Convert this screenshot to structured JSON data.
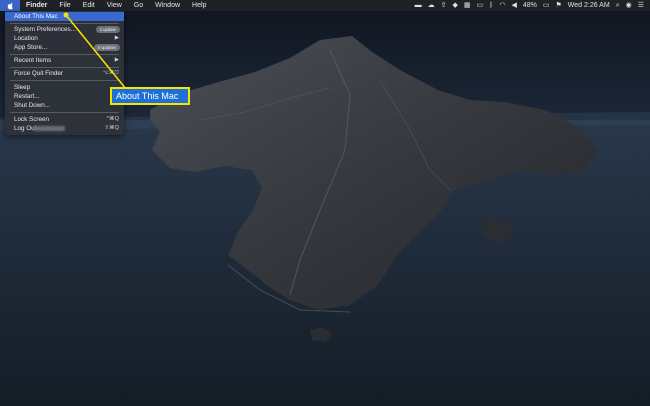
{
  "colors": {
    "accent": "#3a6ad0",
    "callout_border": "#f3e600",
    "callout_fill": "#1e6fd6"
  },
  "menubar": {
    "apple_icon": "apple-icon",
    "app_name": "Finder",
    "items": [
      "File",
      "Edit",
      "View",
      "Go",
      "Window",
      "Help"
    ],
    "status": {
      "battery": "48%",
      "clock": "Wed 2:26 AM"
    }
  },
  "apple_menu": {
    "about": "About This Mac",
    "system_prefs": "System Preferences...",
    "system_prefs_badge": "1 update",
    "location": "Location",
    "app_store": "App Store...",
    "app_store_badge": "8 updates",
    "recent_items": "Recent Items",
    "force_quit": "Force Quit Finder",
    "force_quit_shortcut": "⌥⌘⎋",
    "sleep": "Sleep",
    "restart": "Restart...",
    "shut_down": "Shut Down...",
    "lock_screen": "Lock Screen",
    "lock_screen_shortcut": "^⌘Q",
    "log_out": "Log Out",
    "log_out_shortcut": "⇧⌘Q"
  },
  "callout": {
    "label": "About This Mac"
  }
}
